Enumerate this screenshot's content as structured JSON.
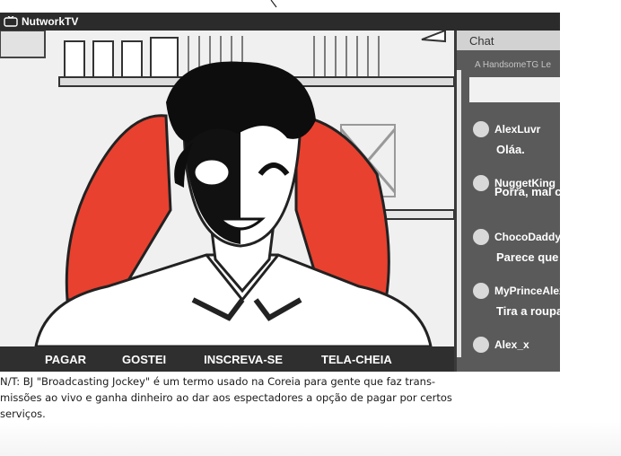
{
  "window": {
    "brand": "NutworkTV",
    "brand_icon": "tv-icon"
  },
  "controls": {
    "pay": "PAGAR",
    "like": "GOSTEI",
    "subscribe": "INSCREVA-SE",
    "fullscreen": "TELA-CHEIA"
  },
  "chat": {
    "header": "Chat",
    "subheader": "A HandsomeTG Le",
    "messages": [
      {
        "user": "AlexLuvr",
        "text": "Oláa."
      },
      {
        "user": "NuggetKing",
        "text": "Porra, mal c"
      },
      {
        "user": "ChocoDaddy",
        "text": "Parece que"
      },
      {
        "user": "MyPrinceAlex",
        "text": "Tira a roupa"
      },
      {
        "user": "Alex_x",
        "text": ""
      }
    ]
  },
  "caption": {
    "line1": "N/T: BJ \"Broadcasting Jockey\" é um termo usado na Coreia para gente que faz trans-",
    "line2": "missões ao vivo e ganha dinheiro ao dar aos espectadores a opção de pagar por certos",
    "line3": "serviços."
  },
  "colors": {
    "titlebar": "#2b2b2b",
    "controls": "#2f2f2f",
    "chat_panel": "#5a5a5a",
    "chair": "#e8412f"
  }
}
